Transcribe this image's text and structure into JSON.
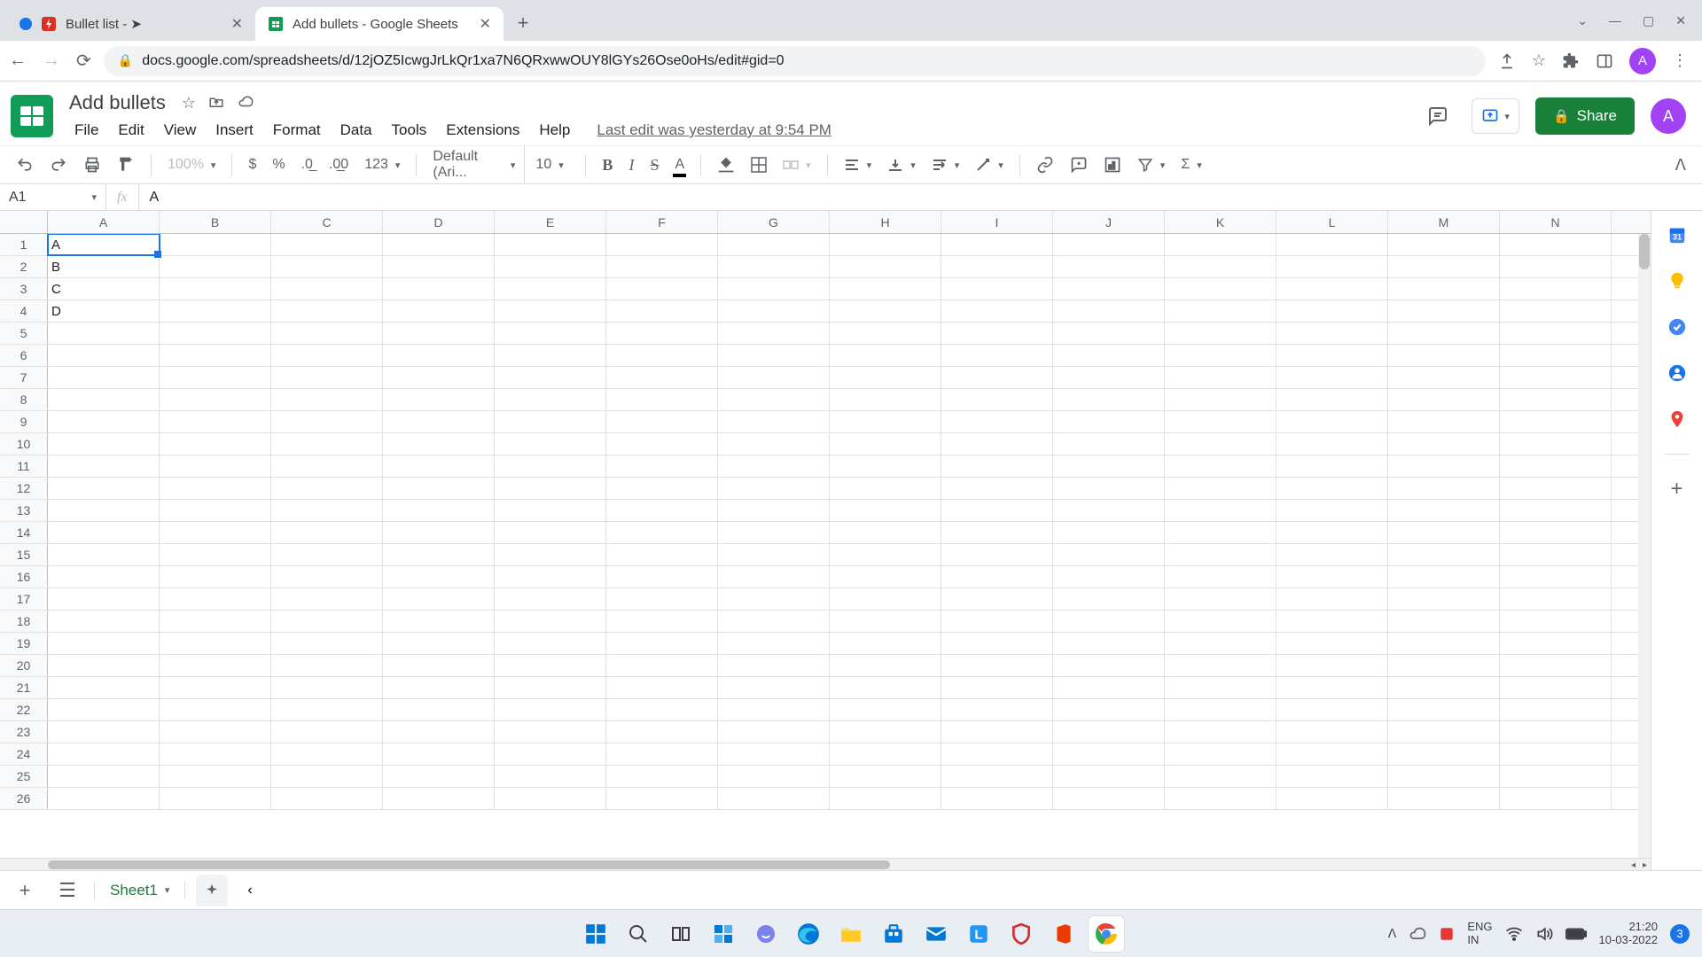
{
  "browser": {
    "tabs": [
      {
        "title": "Bullet list - ➤",
        "favicon": "bolt",
        "loading": true
      },
      {
        "title": "Add bullets - Google Sheets",
        "favicon": "sheets",
        "active": true
      }
    ],
    "url": "docs.google.com/spreadsheets/d/12jOZ5IcwgJrLkQr1xa7N6QRxwwOUY8lGYs26Ose0oHs/edit#gid=0",
    "avatar_letter": "A"
  },
  "doc": {
    "title": "Add bullets",
    "last_edit": "Last edit was yesterday at 9:54 PM",
    "menus": [
      "File",
      "Edit",
      "View",
      "Insert",
      "Format",
      "Data",
      "Tools",
      "Extensions",
      "Help"
    ],
    "share_label": "Share"
  },
  "toolbar": {
    "zoom": "100%",
    "format_items": [
      "$",
      "%",
      ".0",
      ".00",
      "123"
    ],
    "font": "Default (Ari...",
    "font_size": "10"
  },
  "name_box": "A1",
  "formula_value": "A",
  "columns": [
    "A",
    "B",
    "C",
    "D",
    "E",
    "F",
    "G",
    "H",
    "I",
    "J",
    "K",
    "L",
    "M",
    "N"
  ],
  "row_count": 26,
  "cells": {
    "A1": "A",
    "A2": "B",
    "A3": "C",
    "A4": "D"
  },
  "active_cell": "A1",
  "sheet_tab": "Sheet1",
  "system": {
    "lang_top": "ENG",
    "lang_bottom": "IN",
    "time": "21:20",
    "date": "10-03-2022",
    "notif_count": "3"
  }
}
